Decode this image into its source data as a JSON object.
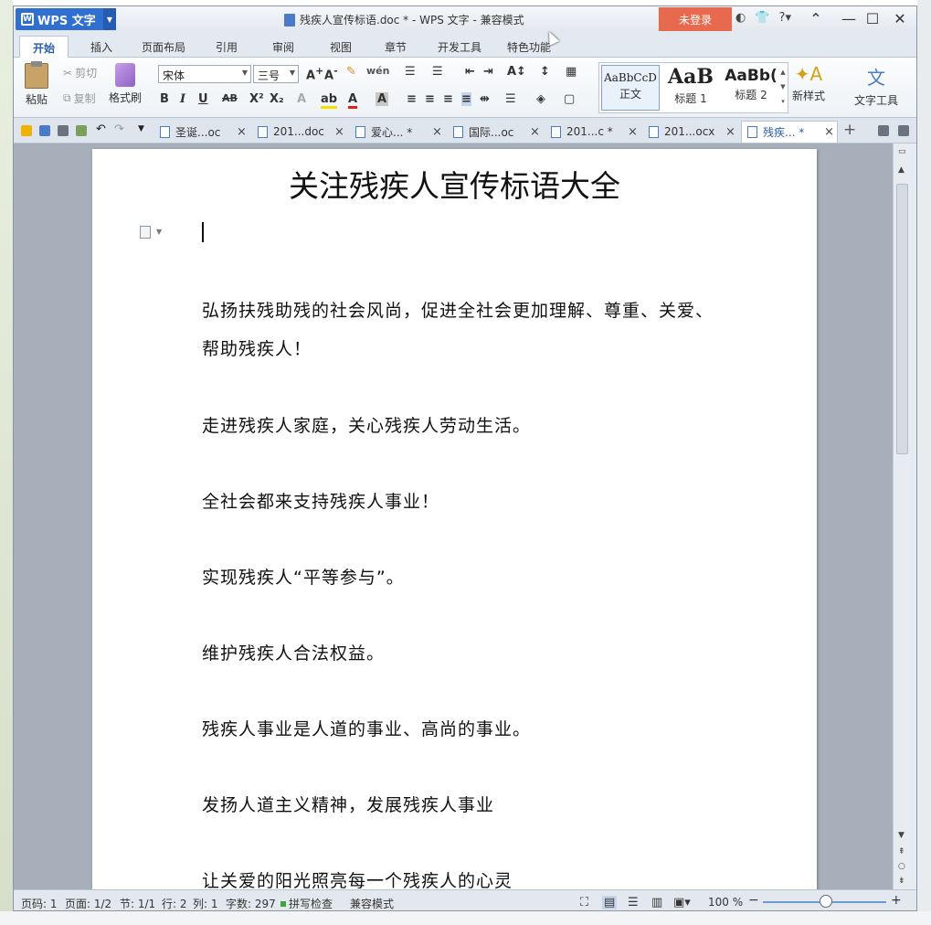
{
  "app": {
    "name": "WPS 文字",
    "window_title": "残疾人宣传标语.doc * - WPS 文字 - 兼容模式",
    "login": "未登录",
    "help": "?"
  },
  "menu": {
    "tabs": [
      "开始",
      "插入",
      "页面布局",
      "引用",
      "审阅",
      "视图",
      "章节",
      "开发工具",
      "特色功能"
    ]
  },
  "ribbon": {
    "paste": "粘贴",
    "cut": "剪切",
    "copy": "复制",
    "format_painter": "格式刷",
    "font_name": "宋体",
    "font_size": "三号",
    "styles": [
      {
        "sample": "AaBbCcD",
        "label": "正文"
      },
      {
        "sample": "AaB",
        "label": "标题 1"
      },
      {
        "sample": "AaBb(",
        "label": "标题 2"
      }
    ],
    "new_style": "新样式",
    "text_tools": "文字工具"
  },
  "doc_tabs": [
    {
      "label": "圣诞...oc"
    },
    {
      "label": "201...doc"
    },
    {
      "label": "爱心... *"
    },
    {
      "label": "国际...oc"
    },
    {
      "label": "201...c *"
    },
    {
      "label": "201...ocx"
    },
    {
      "label": "残疾... *"
    }
  ],
  "document": {
    "title": "关注残疾人宣传标语大全",
    "paragraphs": [
      "弘扬扶残助残的社会风尚，促进全社会更加理解、尊重、关爱、帮助残疾人！",
      "走进残疾人家庭，关心残疾人劳动生活。",
      "全社会都来支持残疾人事业！",
      "实现残疾人“平等参与”。",
      "维护残疾人合法权益。",
      "残疾人事业是人道的事业、高尚的事业。",
      "发扬人道主义精神，发展残疾人事业",
      "让关爱的阳光照亮每一个残疾人的心灵"
    ]
  },
  "status": {
    "page_code": "页码: 1",
    "pages": "页面: 1/2",
    "section": "节: 1/1",
    "row": "行: 2",
    "col": "列: 1",
    "word_count": "字数: 297",
    "spell": "拼写检查",
    "compat": "兼容模式",
    "zoom": "100 %"
  }
}
